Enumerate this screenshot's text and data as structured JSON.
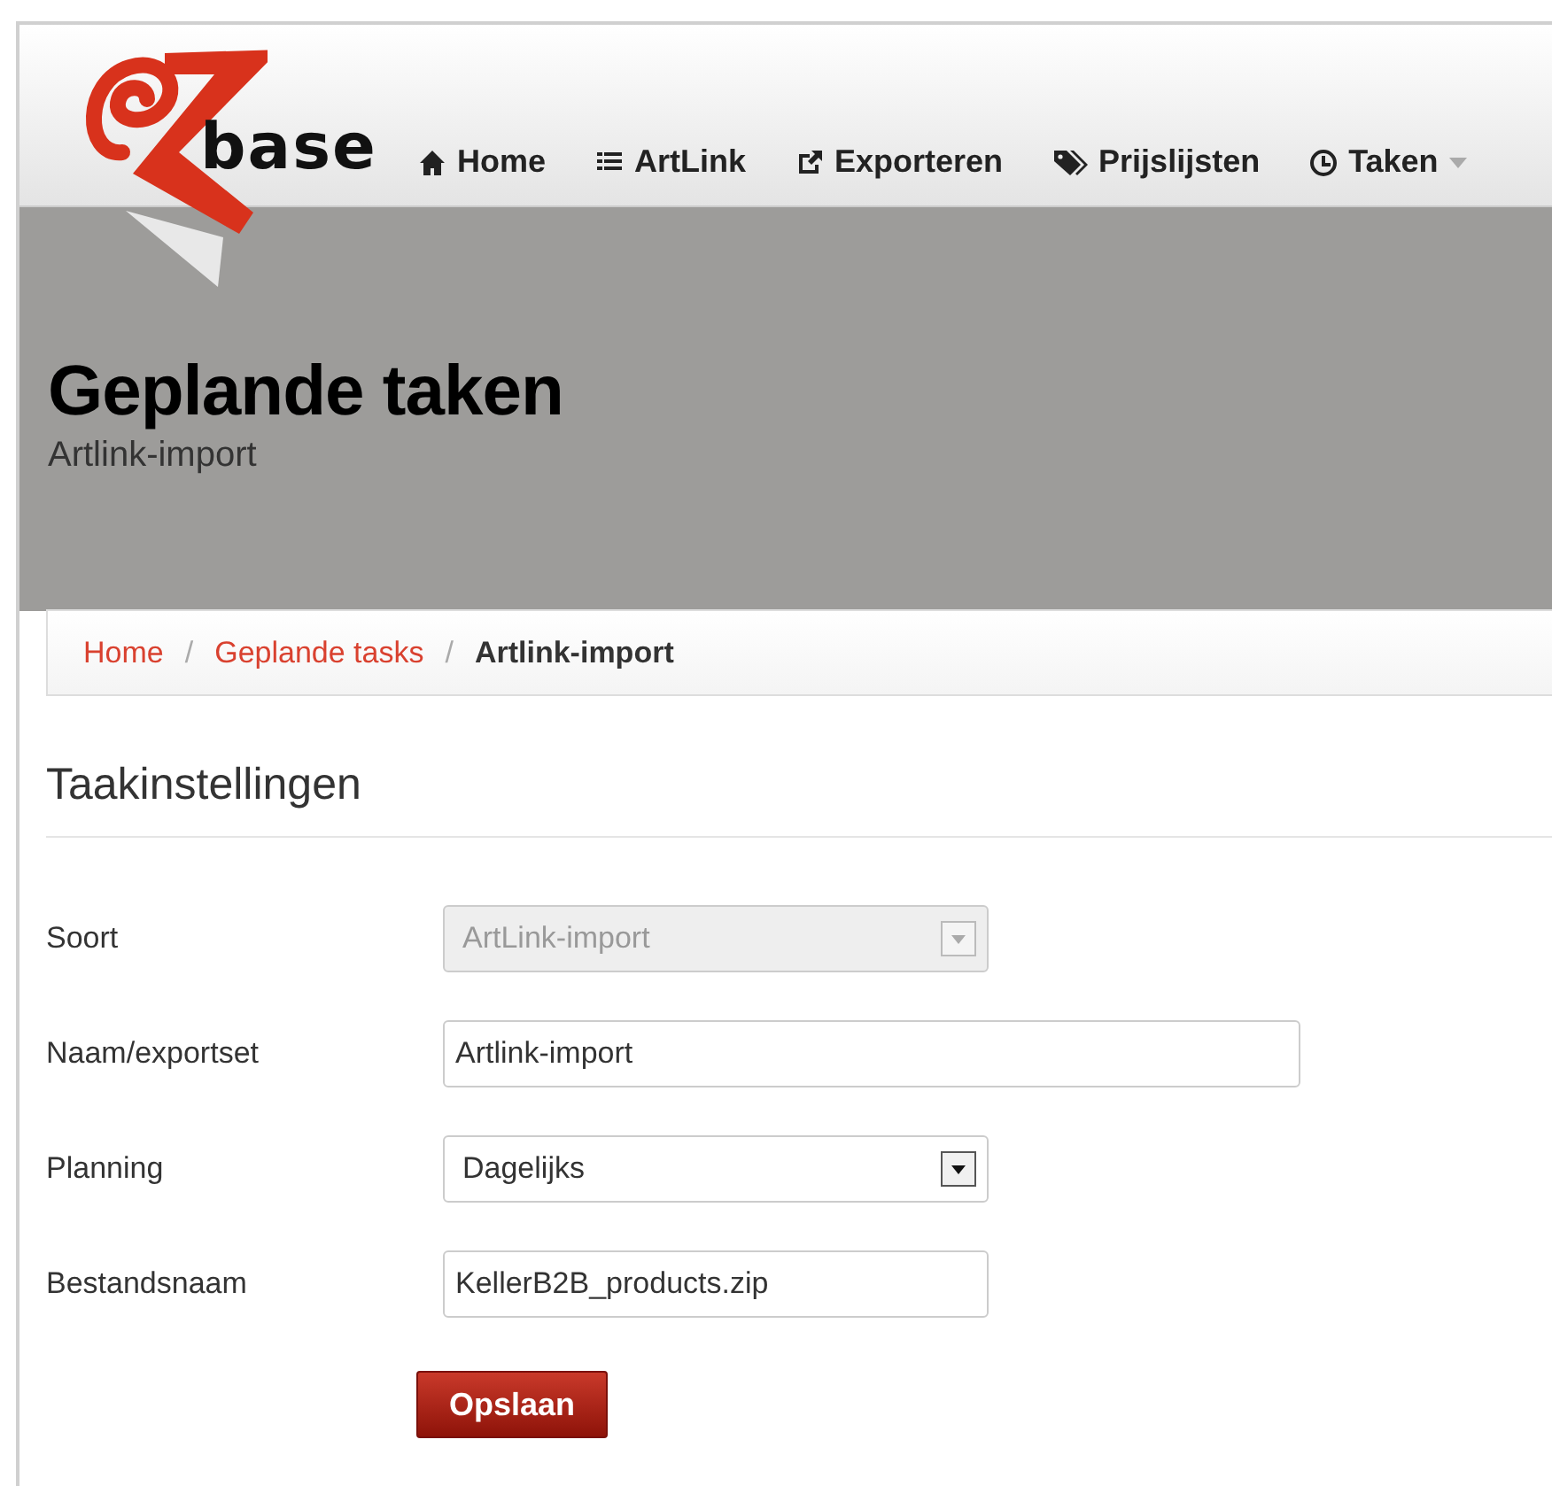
{
  "logo": {
    "text": "base"
  },
  "nav": [
    {
      "label": "Home",
      "kind": "home"
    },
    {
      "label": "ArtLink",
      "kind": "list"
    },
    {
      "label": "Exporteren",
      "kind": "export"
    },
    {
      "label": "Prijslijsten",
      "kind": "tags"
    },
    {
      "label": "Taken",
      "kind": "clock",
      "dropdown": true
    }
  ],
  "header": {
    "title": "Geplande taken",
    "subtitle": "Artlink-import"
  },
  "breadcrumb": [
    {
      "label": "Home",
      "link": true
    },
    {
      "label": "Geplande tasks",
      "link": true
    },
    {
      "label": "Artlink-import",
      "link": false
    }
  ],
  "breadcrumb_separator": "/",
  "section_title": "Taakinstellingen",
  "fields": [
    {
      "label": "Soort",
      "kind": "select",
      "value": "ArtLink-import",
      "disabled": true,
      "wide": false
    },
    {
      "label": "Naam/exportset",
      "kind": "text",
      "value": "Artlink-import",
      "disabled": false,
      "wide": true
    },
    {
      "label": "Planning",
      "kind": "select",
      "value": "Dagelijks",
      "disabled": false,
      "wide": false
    },
    {
      "label": "Bestandsnaam",
      "kind": "text",
      "value": "KellerB2B_products.zip",
      "disabled": false,
      "wide": false
    }
  ],
  "submit": "Opslaan"
}
